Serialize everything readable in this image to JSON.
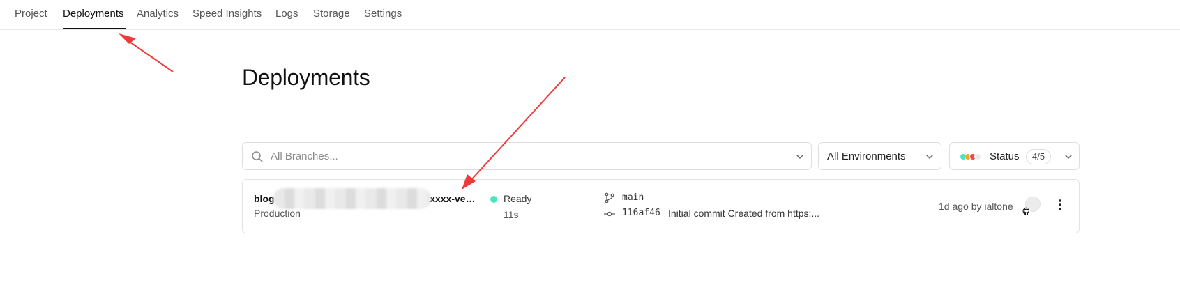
{
  "nav": {
    "tabs": [
      {
        "label": "Project"
      },
      {
        "label": "Deployments"
      },
      {
        "label": "Analytics"
      },
      {
        "label": "Speed Insights"
      },
      {
        "label": "Logs"
      },
      {
        "label": "Storage"
      },
      {
        "label": "Settings"
      }
    ],
    "active_tab": "Deployments"
  },
  "page": {
    "title": "Deployments"
  },
  "filters": {
    "search_placeholder": "All Branches...",
    "environment_label": "All Environments",
    "status_label": "Status",
    "status_count": "4/5",
    "status_dot_colors": [
      "#50e3c2",
      "#f5a623",
      "#e5484d",
      "#eaeaea"
    ]
  },
  "deployment": {
    "url": "blog-xxxxxxxxxxxxxxxxxxxxxxxxxxxxxxxx-vercel.app",
    "environment": "Production",
    "status": "Ready",
    "status_color": "#50e3c2",
    "duration": "11s",
    "branch": "main",
    "commit_hash": "116af46",
    "commit_message": "Initial commit Created from https:...",
    "meta": "1d ago by ialtone"
  },
  "icons": [
    "search-icon",
    "chevron-down-icon",
    "git-branch-icon",
    "git-commit-icon",
    "github-icon",
    "more-vertical-icon"
  ],
  "annotation_color": "#f03a3a"
}
